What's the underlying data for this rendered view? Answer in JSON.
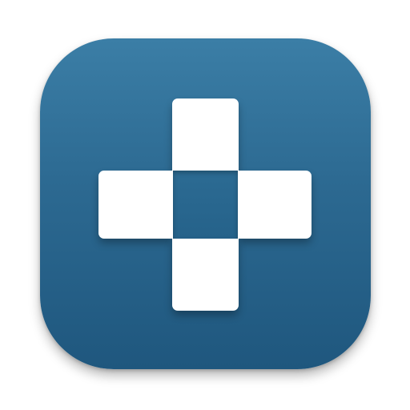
{
  "app_icon": {
    "icon_name": "plus-cross-icon",
    "colors": {
      "background_top": "#3b7ea6",
      "background_bottom": "#1f577e",
      "tile": "#ffffff"
    }
  }
}
